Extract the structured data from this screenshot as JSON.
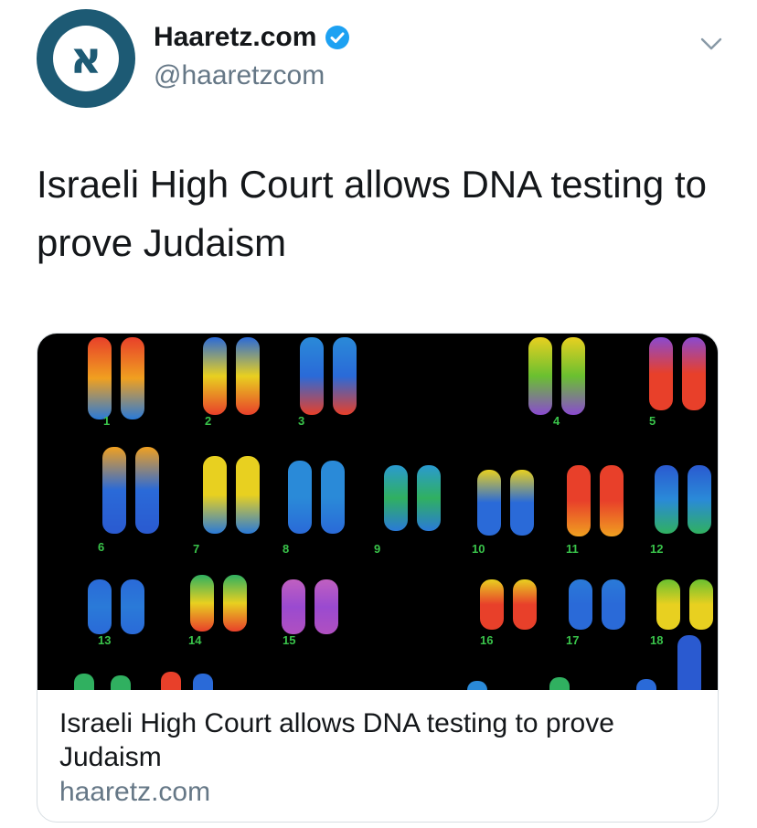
{
  "account": {
    "display_name": "Haaretz.com",
    "handle": "@haaretzcom",
    "verified": true,
    "avatar_icon": "haaretz-logo-icon",
    "avatar_letter": "א",
    "avatar_color": "#1d5a74"
  },
  "tweet": {
    "text": "Israeli High Court allows DNA testing to prove Judaism"
  },
  "card": {
    "image_description_icon": "chromosome-karyotype-image",
    "chromosome_labels": [
      "1",
      "2",
      "3",
      "4",
      "5",
      "6",
      "7",
      "8",
      "9",
      "10",
      "11",
      "12",
      "13",
      "14",
      "15",
      "16",
      "17",
      "18"
    ],
    "title": "Israeli High Court allows DNA testing to prove Judaism",
    "domain": "haaretz.com"
  },
  "colors": {
    "verified_blue": "#1da1f2",
    "text_primary": "#14171a",
    "text_secondary": "#657786",
    "label_green": "#39c34a"
  }
}
